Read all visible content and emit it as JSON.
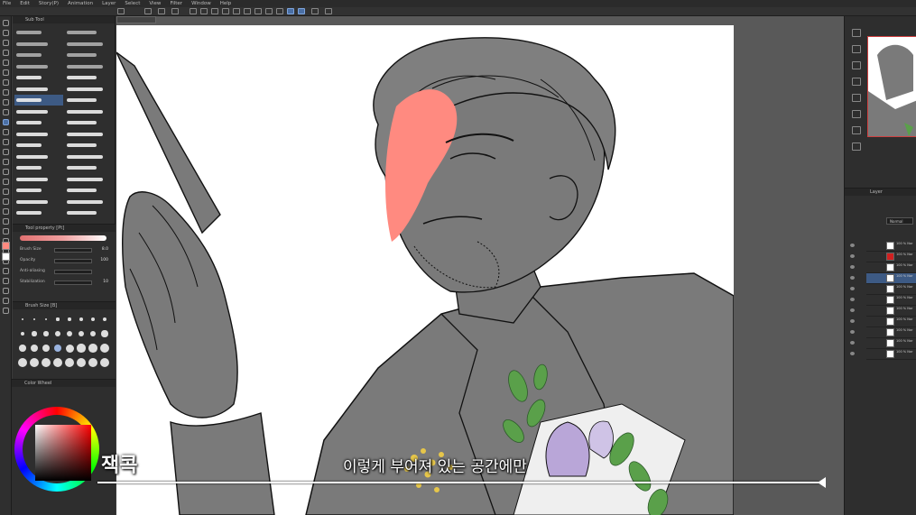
{
  "menu": [
    "File",
    "Edit",
    "Story(P)",
    "Animation",
    "Layer",
    "Select",
    "View",
    "Filter",
    "Window",
    "Help"
  ],
  "subtool": {
    "tab_label": "Sub Tool"
  },
  "tool_property": {
    "tab_label": "Tool property [Pt]",
    "rows": [
      {
        "label": "Brush Size",
        "value": "8.0"
      },
      {
        "label": "Opacity",
        "value": "100"
      },
      {
        "label": "Anti-aliasing",
        "value": ""
      },
      {
        "label": "Stabilization",
        "value": "10"
      }
    ]
  },
  "brush_size_panel": {
    "tab_label": "Brush Size [B]"
  },
  "color_panel": {
    "tab_label": "Color Wheel"
  },
  "layer_panel": {
    "tab_label": "Layer",
    "blend_mode": "Normal",
    "layers": [
      {
        "name": "100 % Nor",
        "selected": false
      },
      {
        "name": "100 % Nor",
        "selected": false
      },
      {
        "name": "100 % Nor",
        "selected": false
      },
      {
        "name": "100 % Nor",
        "selected": true
      },
      {
        "name": "100 % Nor",
        "selected": false
      },
      {
        "name": "100 % Nor",
        "selected": false
      },
      {
        "name": "100 % Nor",
        "selected": false
      },
      {
        "name": "100 % Nor",
        "selected": false
      },
      {
        "name": "100 % Nor",
        "selected": false
      },
      {
        "name": "100 % Nor",
        "selected": false
      },
      {
        "name": "100 % Nor",
        "selected": false
      }
    ]
  },
  "video": {
    "caption": "이렇게 부어져 있는 공간에만",
    "channel": "잭콕",
    "progress": 0.995
  },
  "colors": {
    "skin_highlight": "#ff8a80",
    "flat_gray": "#7a7a7a",
    "leaf_green": "#5aa04a",
    "flower_purple": "#b9a6d8",
    "mimosa_yellow": "#e6c64a",
    "accent_blue": "#3d6fb2"
  }
}
